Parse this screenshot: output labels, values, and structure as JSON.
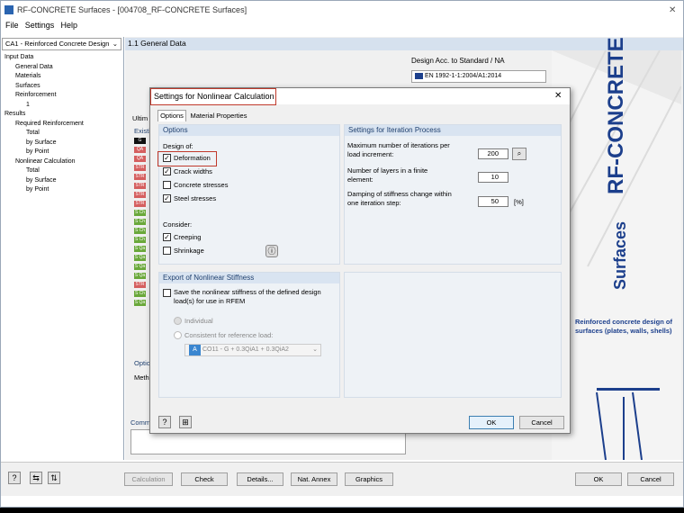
{
  "window": {
    "title": "RF-CONCRETE Surfaces - [004708_RF-CONCRETE Surfaces]",
    "close": "✕"
  },
  "menu": [
    "File",
    "Settings",
    "Help"
  ],
  "nav": {
    "combo": "CA1 - Reinforced Concrete Design",
    "tree": [
      "Input Data",
      "General Data",
      "Materials",
      "Surfaces",
      "Reinforcement",
      "1",
      "Results",
      "Required Reinforcement",
      "Total",
      "by Surface",
      "by Point",
      "Nonlinear Calculation",
      "Total",
      "by Surface",
      "by Point"
    ]
  },
  "main": {
    "header": "1.1 General Data",
    "design_label": "Design Acc. to Standard / NA",
    "standard": "EN 1992-1-1:2004/A1:2014",
    "tab_partial": "Ultim",
    "exist_label": "Existi",
    "opt_label": "Optic",
    "meth_label": "Meth",
    "comment_label": "Comm"
  },
  "banner": {
    "title": "RF-CONCRETE",
    "subtitle": "Surfaces",
    "desc": "Reinforced concrete design of surfaces (plates, walls, shells)",
    "colors": {
      "blue": "#1c3f8c",
      "red": "#c8102e"
    }
  },
  "dialog": {
    "title": "Settings for Nonlinear Calculation",
    "tabs": [
      "Options",
      "Material Properties"
    ],
    "options": {
      "header": "Options",
      "design_of": "Design of:",
      "items": [
        {
          "label": "Deformation",
          "checked": true
        },
        {
          "label": "Crack widths",
          "checked": true
        },
        {
          "label": "Concrete stresses",
          "checked": false
        },
        {
          "label": "Steel stresses",
          "checked": true
        }
      ],
      "consider": "Consider:",
      "consider_items": [
        {
          "label": "Creeping",
          "checked": true
        },
        {
          "label": "Shrinkage",
          "checked": false
        }
      ]
    },
    "iteration": {
      "header": "Settings for Iteration Process",
      "max_iter_label": "Maximum number of iterations per load increment:",
      "max_iter": "200",
      "layers_label": "Number of layers in a finite element:",
      "layers": "10",
      "damping_label": "Damping of stiffness change within one iteration step:",
      "damping": "50",
      "damping_unit": "[%]"
    },
    "export": {
      "header": "Export of Nonlinear Stiffness",
      "save_label": "Save the nonlinear stiffness of the defined design load(s) for use in RFEM",
      "individual": "Individual",
      "consistent": "Consistent for reference load:",
      "ref_tag": "A",
      "ref_load": "CO11 - G + 0.3QiA1 + 0.3QiA2"
    },
    "ok": "OK",
    "cancel": "Cancel"
  },
  "bottom": {
    "calculation": "Calculation",
    "check": "Check",
    "details": "Details...",
    "nat_annex": "Nat. Annex",
    "graphics": "Graphics",
    "ok": "OK",
    "cancel": "Cancel"
  },
  "left_tags": [
    {
      "t": "G",
      "c": "#111111"
    },
    {
      "t": "QA",
      "c": "#d55f5f"
    },
    {
      "t": "QA",
      "c": "#d55f5f"
    },
    {
      "t": "STR",
      "c": "#d55f5f"
    },
    {
      "t": "STR",
      "c": "#d55f5f"
    },
    {
      "t": "STR",
      "c": "#d55f5f"
    },
    {
      "t": "STR",
      "c": "#d55f5f"
    },
    {
      "t": "STR",
      "c": "#d55f5f"
    },
    {
      "t": "S Ch",
      "c": "#6aa83a"
    },
    {
      "t": "S Ch",
      "c": "#6aa83a"
    },
    {
      "t": "S Ch",
      "c": "#6aa83a"
    },
    {
      "t": "S Ch",
      "c": "#6aa83a"
    },
    {
      "t": "S Qa",
      "c": "#6aa83a"
    },
    {
      "t": "S Qa",
      "c": "#6aa83a"
    },
    {
      "t": "S Qa",
      "c": "#6aa83a"
    },
    {
      "t": "S Qa",
      "c": "#6aa83a"
    },
    {
      "t": "STR",
      "c": "#d55f5f"
    },
    {
      "t": "S Ch",
      "c": "#6aa83a"
    },
    {
      "t": "S Qa",
      "c": "#6aa83a"
    }
  ]
}
